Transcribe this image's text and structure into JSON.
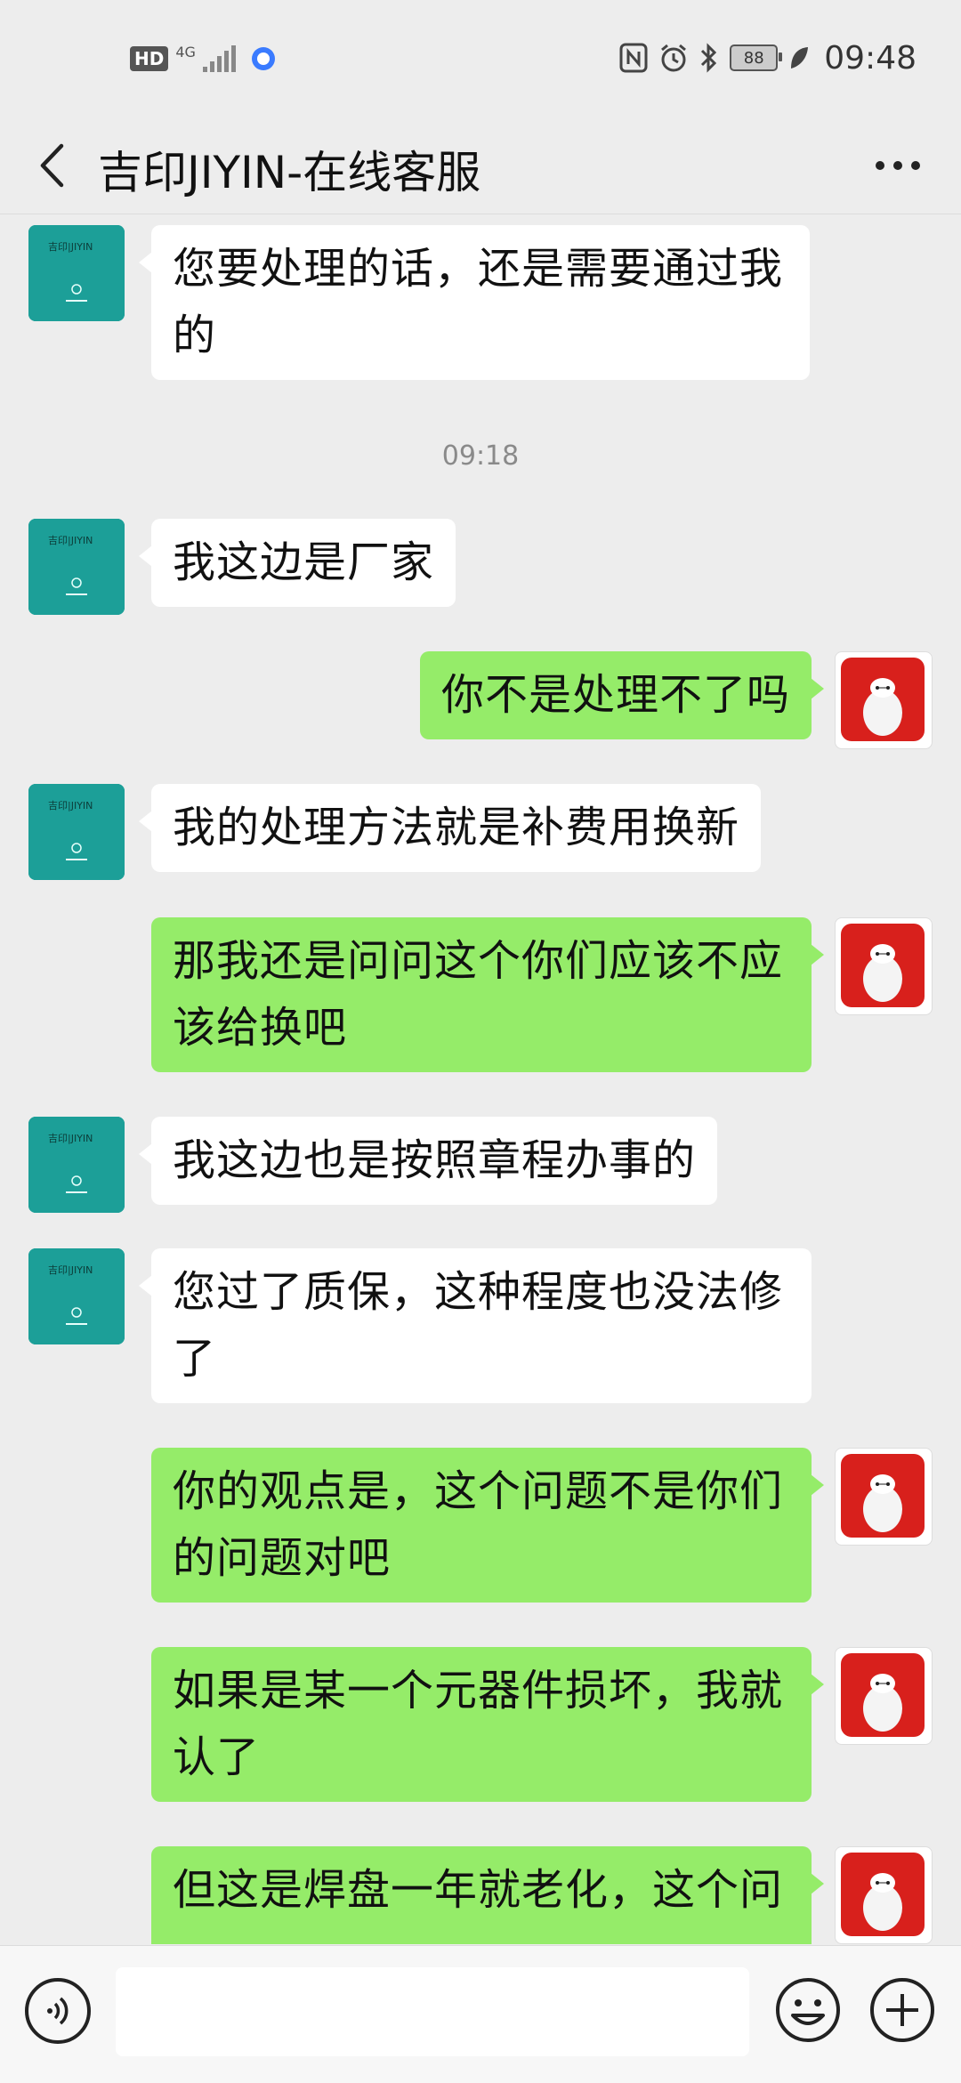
{
  "status_bar": {
    "hd_label": "HD",
    "network_label": "4G",
    "battery_level": "88",
    "time": "09:48",
    "icons": [
      "nfc-icon",
      "alarm-icon",
      "bluetooth-icon",
      "battery-icon",
      "leaf-icon"
    ]
  },
  "header": {
    "title": "吉印JIYIN-在线客服",
    "back_icon": "chevron-left-icon",
    "more_icon": "more-dots-icon"
  },
  "chat": {
    "timestamp": "09:18",
    "messages": [
      {
        "from": "agent",
        "text": "您要处理的话，还是需要通过我的"
      },
      {
        "from": "agent",
        "text": "我这边是厂家"
      },
      {
        "from": "me",
        "text": "你不是处理不了吗"
      },
      {
        "from": "agent",
        "text": "我的处理方法就是补费用换新"
      },
      {
        "from": "me",
        "text": "那我还是问问这个你们应该不应该给换吧"
      },
      {
        "from": "agent",
        "text": "我这边也是按照章程办事的"
      },
      {
        "from": "agent",
        "text": "您过了质保，这种程度也没法修了"
      },
      {
        "from": "me",
        "text": "你的观点是，这个问题不是你们的问题对吧"
      },
      {
        "from": "me",
        "text": "如果是某一个元器件损坏，我就认了"
      },
      {
        "from": "me",
        "text": "但这是焊盘一年就老化，这个问"
      }
    ]
  },
  "input_bar": {
    "voice_icon": "voice-icon",
    "emoji_icon": "emoji-icon",
    "plus_icon": "plus-icon",
    "value": "",
    "placeholder": ""
  },
  "colors": {
    "background": "#ededed",
    "my_bubble": "#95ec69",
    "agent_bubble": "#ffffff",
    "agent_avatar": "#1c9f98",
    "my_avatar_red": "#d8201c"
  }
}
